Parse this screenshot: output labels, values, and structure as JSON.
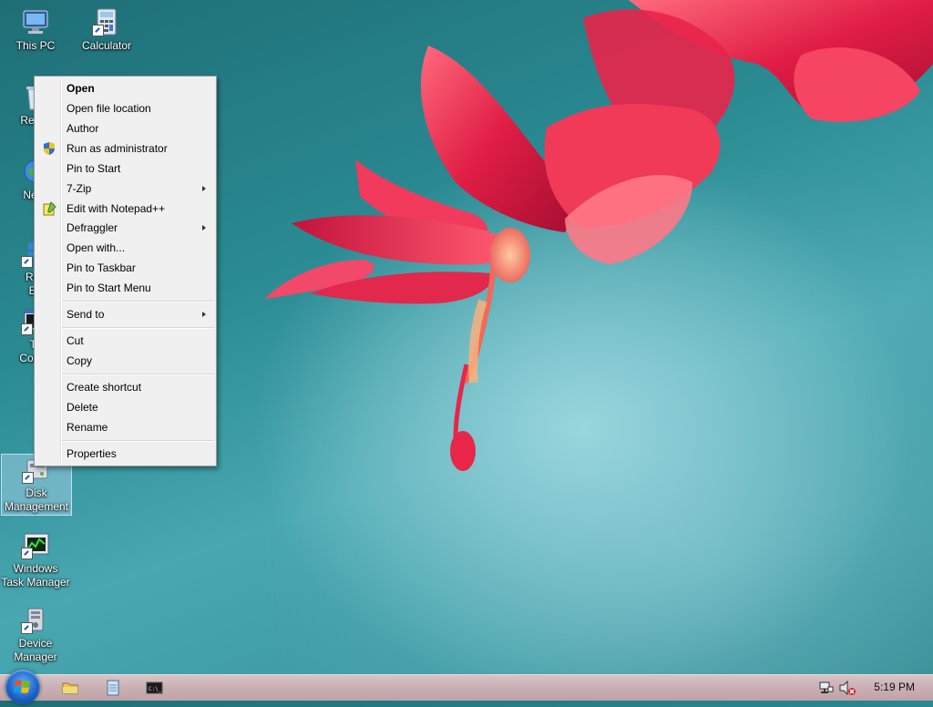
{
  "desktop": {
    "icons": [
      {
        "label": "This PC",
        "icon": "computer-icon"
      },
      {
        "label": "Calculator",
        "icon": "calculator-icon"
      },
      {
        "label": "Recyc",
        "icon": "recycle-bin-icon"
      },
      {
        "label": "Netw",
        "icon": "network-icon"
      },
      {
        "label_line1": "Reg",
        "label_line2": "Ed",
        "icon": "registry-editor-icon"
      },
      {
        "label_line1": "To",
        "label_line2": "Comm",
        "icon": "command-prompt-icon"
      },
      {
        "label_line1": "Disk",
        "label_line2": "Management",
        "icon": "disk-management-icon",
        "selected": true
      },
      {
        "label_line1": "Windows",
        "label_line2": "Task Manager",
        "icon": "task-manager-icon"
      },
      {
        "label_line1": "Device",
        "label_line2": "Manager",
        "icon": "device-manager-icon"
      }
    ]
  },
  "context_menu": {
    "items": [
      {
        "label": "Open",
        "bold": true
      },
      {
        "label": "Open file location"
      },
      {
        "label": "Author"
      },
      {
        "label": "Run as administrator",
        "icon": "uac-shield-icon"
      },
      {
        "label": "Pin to Start"
      },
      {
        "label": "7-Zip",
        "submenu": true
      },
      {
        "label": "Edit with Notepad++",
        "icon": "notepad-plus-plus-icon"
      },
      {
        "label": "Defraggler",
        "submenu": true
      },
      {
        "label": "Open with..."
      },
      {
        "label": "Pin to Taskbar"
      },
      {
        "label": "Pin to Start Menu"
      },
      {
        "label": "Send to",
        "submenu": true
      },
      {
        "label": "Cut"
      },
      {
        "label": "Copy"
      },
      {
        "label": "Create shortcut"
      },
      {
        "label": "Delete"
      },
      {
        "label": "Rename"
      },
      {
        "label": "Properties"
      }
    ]
  },
  "taskbar": {
    "start_icon": "windows-orb-icon",
    "pinned": [
      "file-explorer-icon",
      "notepad-icon",
      "command-prompt-icon"
    ],
    "tray": {
      "network_icon": "network-tray-icon",
      "volume_icon": "volume-muted-icon",
      "clock": "5:19 PM"
    }
  },
  "colors": {
    "wallpaper_teal": "#2a8a92",
    "flower_red": "#e8264a",
    "taskbar_tint": "#c9afb3",
    "menu_bg": "#f0f0f0"
  }
}
